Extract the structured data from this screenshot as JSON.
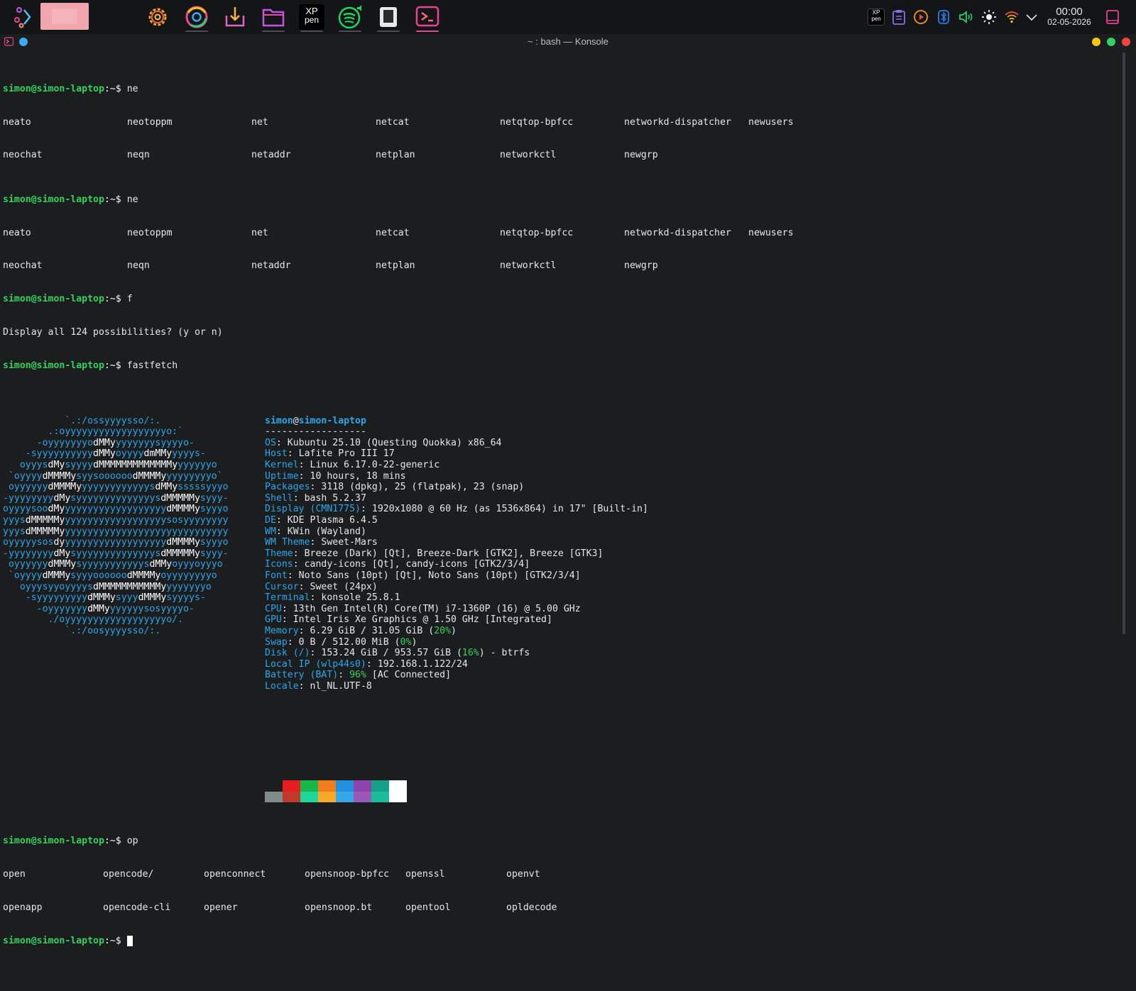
{
  "panel": {
    "launchers": [
      {
        "name": "app-launcher",
        "icon": "launcher-icon"
      },
      {
        "name": "active-window-thumbnail",
        "icon": "window-thumbnail"
      },
      {
        "name": "system-settings",
        "icon": "gear-icon"
      },
      {
        "name": "chrome",
        "icon": "chrome-icon"
      },
      {
        "name": "discover",
        "icon": "download-icon"
      },
      {
        "name": "dolphin",
        "icon": "folder-icon"
      },
      {
        "name": "xp-pen",
        "icon": "xppen-icon",
        "label": "XP pen"
      },
      {
        "name": "spotify",
        "icon": "spotify-icon"
      },
      {
        "name": "notes",
        "icon": "notes-icon"
      },
      {
        "name": "konsole",
        "icon": "terminal-icon"
      }
    ],
    "tray": [
      "xppen-tray-icon",
      "clipboard-icon",
      "media-icon",
      "bluetooth-icon",
      "volume-icon",
      "brightness-icon",
      "wifi-icon",
      "chevron-down-icon"
    ],
    "clock": {
      "time": "00:00",
      "date": "02-05-2026"
    },
    "xppen_label_top": "XP",
    "xppen_label_bottom": "pen",
    "accent": "#e84393"
  },
  "window": {
    "title": "~ : bash — Konsole",
    "buttons": {
      "minimize": "#f3c812",
      "maximize": "#33d15f",
      "close": "#f0463a"
    }
  },
  "terminal": {
    "prompt_user": "simon@simon-laptop",
    "prompt_sep": ":~$",
    "lines": {
      "cmd1": " ne",
      "ne_row1": [
        "neato",
        "neotoppm",
        "net",
        "netcat",
        "netqtop-bpfcc",
        "networkd-dispatcher",
        "newusers"
      ],
      "ne_row2": [
        "neochat",
        "neqn",
        "netaddr",
        "netplan",
        "networkctl",
        "newgrp"
      ],
      "cmd2": " ne",
      "cmd3": " f",
      "display_all": "Display all 124 possibilities? (y or n)",
      "cmd4": " fastfetch",
      "cmd5": " op",
      "op_row1": [
        "open",
        "opencode/",
        "openconnect",
        "opensnoop-bpfcc",
        "openssl",
        "openvt"
      ],
      "op_row2": [
        "openapp",
        "opencode-cli",
        "opener",
        "opensnoop.bt",
        "opentool",
        "opldecode"
      ]
    },
    "fastfetch": {
      "user": "simon",
      "at": "@",
      "host": "simon-laptop",
      "separator": "------------------",
      "info": [
        {
          "key": "OS",
          "value": "Kubuntu 25.10 (Questing Quokka) x86_64"
        },
        {
          "key": "Host",
          "value": "Lafite Pro III 17"
        },
        {
          "key": "Kernel",
          "value": "Linux 6.17.0-22-generic"
        },
        {
          "key": "Uptime",
          "value": "10 hours, 18 mins"
        },
        {
          "key": "Packages",
          "value": "3118 (dpkg), 25 (flatpak), 23 (snap)"
        },
        {
          "key": "Shell",
          "value": "bash 5.2.37"
        },
        {
          "key": "Display (CMN1775)",
          "value": "1920x1080 @ 60 Hz (as 1536x864) in 17\" [Built-in]"
        },
        {
          "key": "DE",
          "value": "KDE Plasma 6.4.5"
        },
        {
          "key": "WM",
          "value": "KWin (Wayland)"
        },
        {
          "key": "WM Theme",
          "value": "Sweet-Mars"
        },
        {
          "key": "Theme",
          "value": "Breeze (Dark) [Qt], Breeze-Dark [GTK2], Breeze [GTK3]"
        },
        {
          "key": "Icons",
          "value": "candy-icons [Qt], candy-icons [GTK2/3/4]"
        },
        {
          "key": "Font",
          "value": "Noto Sans (10pt) [Qt], Noto Sans (10pt) [GTK2/3/4]"
        },
        {
          "key": "Cursor",
          "value": "Sweet (24px)"
        },
        {
          "key": "Terminal",
          "value": "konsole 25.8.1"
        },
        {
          "key": "CPU",
          "value": "13th Gen Intel(R) Core(TM) i7-1360P (16) @ 5.00 GHz"
        },
        {
          "key": "GPU",
          "value": "Intel Iris Xe Graphics @ 1.50 GHz [Integrated]"
        }
      ],
      "memory": {
        "key": "Memory",
        "pre": "6.29 GiB / 31.05 GiB (",
        "pct": "20%",
        "post": ")"
      },
      "swap": {
        "key": "Swap",
        "pre": "0 B / 512.00 MiB (",
        "pct": "0%",
        "post": ")"
      },
      "disk": {
        "key": "Disk (/)",
        "pre": "153.24 GiB / 953.57 GiB (",
        "pct": "16%",
        "post": ") - btrfs"
      },
      "localip": {
        "key": "Local IP (wlp44s0)",
        "value": "192.168.1.122/24"
      },
      "battery": {
        "key": "Battery (BAT)",
        "pct": "96%",
        "post": " [AC Connected]"
      },
      "locale": {
        "key": "Locale",
        "value": "nl_NL.UTF-8"
      },
      "palette_top": [
        "#1b1d1f",
        "#e81d24",
        "#16b84a",
        "#f07c1b",
        "#2290e0",
        "#8e44ad",
        "#16a08a",
        "#ffffff"
      ],
      "palette_bottom": [
        "#7f8c8d",
        "#c0392b",
        "#1ed79a",
        "#f7a928",
        "#34a8e8",
        "#9b59b6",
        "#1abc9c",
        "#ffffff"
      ]
    }
  }
}
